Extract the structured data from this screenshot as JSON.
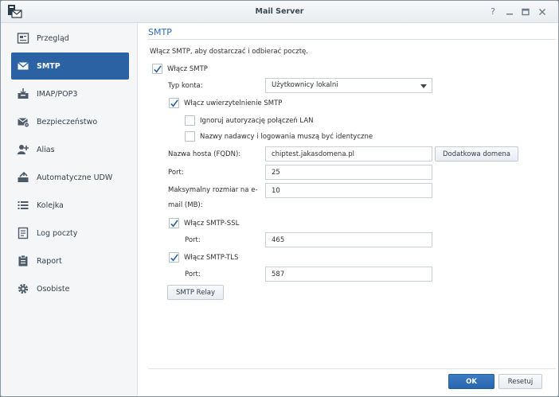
{
  "window": {
    "title": "Mail Server",
    "controls": [
      "help-icon",
      "minimize-icon",
      "maximize-icon",
      "close-icon"
    ]
  },
  "sidebar": {
    "items": [
      {
        "label": "Przegląd",
        "icon": "overview-icon",
        "active": false
      },
      {
        "label": "SMTP",
        "icon": "mail-icon",
        "active": true
      },
      {
        "label": "IMAP/POP3",
        "icon": "inbox-icon",
        "active": false
      },
      {
        "label": "Bezpieczeństwo",
        "icon": "security-mail-icon",
        "active": false
      },
      {
        "label": "Alias",
        "icon": "alias-icon",
        "active": false
      },
      {
        "label": "Automatyczne UDW",
        "icon": "auto-bcc-icon",
        "active": false
      },
      {
        "label": "Kolejka",
        "icon": "list-icon",
        "active": false
      },
      {
        "label": "Log poczty",
        "icon": "log-icon",
        "active": false
      },
      {
        "label": "Raport",
        "icon": "report-icon",
        "active": false
      },
      {
        "label": "Osobiste",
        "icon": "gear-icon",
        "active": false
      }
    ]
  },
  "main": {
    "section_title": "SMTP",
    "description": "Włącz SMTP, aby dostarczać i odbierać pocztę.",
    "enable_smtp": {
      "label": "Włącz SMTP",
      "checked": true
    },
    "account_type": {
      "label": "Typ konta:",
      "value": "Użytkownicy lokalni"
    },
    "smtp_auth": {
      "label": "Włącz uwierzytelnienie SMTP",
      "checked": true
    },
    "ignore_lan": {
      "label": "Ignoruj autoryzację połączeń LAN",
      "checked": false
    },
    "sender_match": {
      "label": "Nazwy nadawcy i logowania muszą być identyczne",
      "checked": false
    },
    "hostname": {
      "label": "Nazwa hosta (FQDN):",
      "value": "chiptest.jakasdomena.pl",
      "button": "Dodatkowa domena"
    },
    "port": {
      "label": "Port:",
      "value": "25"
    },
    "max_size": {
      "label_line1": "Maksymalny rozmiar na e-",
      "label_line2": "mail (MB):",
      "value": "10"
    },
    "smtp_ssl": {
      "label": "Włącz SMTP-SSL",
      "checked": true,
      "port_label": "Port:",
      "port_value": "465"
    },
    "smtp_tls": {
      "label": "Włącz SMTP-TLS",
      "checked": true,
      "port_label": "Port:",
      "port_value": "587"
    },
    "relay_button": "SMTP Relay"
  },
  "footer": {
    "ok": "OK",
    "reset": "Resetuj"
  },
  "colors": {
    "accent": "#2a62a3",
    "title_blue": "#2d6db3"
  }
}
